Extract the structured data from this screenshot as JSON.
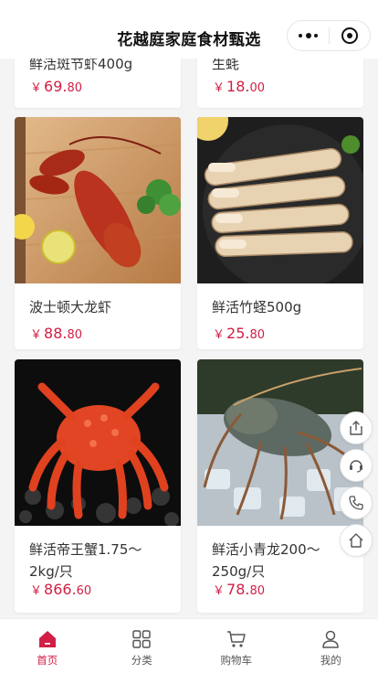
{
  "header": {
    "title": "花越庭家庭食材甄选"
  },
  "products": [
    {
      "name": "鲜活斑节虾400g",
      "price_int": "69.",
      "price_dec": "80"
    },
    {
      "name": "生蚝",
      "price_int": "18.",
      "price_dec": "00"
    },
    {
      "name": "波士顿大龙虾",
      "price_int": "88.",
      "price_dec": "80"
    },
    {
      "name": "鲜活竹蛏500g",
      "price_int": "25.",
      "price_dec": "80"
    },
    {
      "name": "鲜活帝王蟹1.75～2kg/只",
      "price_int": "866.",
      "price_dec": "60"
    },
    {
      "name": "鲜活小青龙200～250g/只",
      "price_int": "78.",
      "price_dec": "80"
    }
  ],
  "currency": "￥",
  "tabs": [
    {
      "label": "首页",
      "icon": "home-icon",
      "active": true
    },
    {
      "label": "分类",
      "icon": "category-grid-icon",
      "active": false
    },
    {
      "label": "购物车",
      "icon": "cart-icon",
      "active": false
    },
    {
      "label": "我的",
      "icon": "user-icon",
      "active": false
    }
  ],
  "floating": [
    "share-icon",
    "customer-service-icon",
    "phone-icon",
    "home-icon"
  ],
  "colors": {
    "accent": "#d11f45",
    "background": "#f4f4f4"
  }
}
